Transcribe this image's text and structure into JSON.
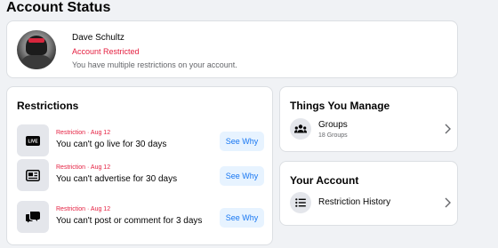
{
  "page": {
    "title": "Account Status"
  },
  "profile": {
    "name": "Dave Schultz",
    "status": "Account Restricted",
    "description": "You have multiple restrictions on your account."
  },
  "restrictions": {
    "title": "Restrictions",
    "items": [
      {
        "meta": "Restriction · Aug 12",
        "text": "You can't go live for 30 days",
        "icon": "live-icon",
        "button": "See Why"
      },
      {
        "meta": "Restriction · Aug 12",
        "text": "You can't advertise for 30 days",
        "icon": "advertise-icon",
        "button": "See Why"
      },
      {
        "meta": "Restriction · Aug 12",
        "text": "You can't post or comment for 3 days",
        "icon": "comment-icon",
        "button": "See Why"
      }
    ]
  },
  "things_you_manage": {
    "title": "Things You Manage",
    "items": [
      {
        "label": "Groups",
        "sub": "18 Groups",
        "icon": "groups-icon"
      }
    ]
  },
  "your_account": {
    "title": "Your Account",
    "items": [
      {
        "label": "Restriction History",
        "icon": "list-icon"
      }
    ]
  },
  "colors": {
    "background": "#f0f2f5",
    "card": "#ffffff",
    "restriction_red": "#e41e3f",
    "link_blue": "#1877f2",
    "button_bg": "#e7f3ff",
    "icon_bg": "#e4e6eb",
    "secondary_text": "#65676b"
  }
}
